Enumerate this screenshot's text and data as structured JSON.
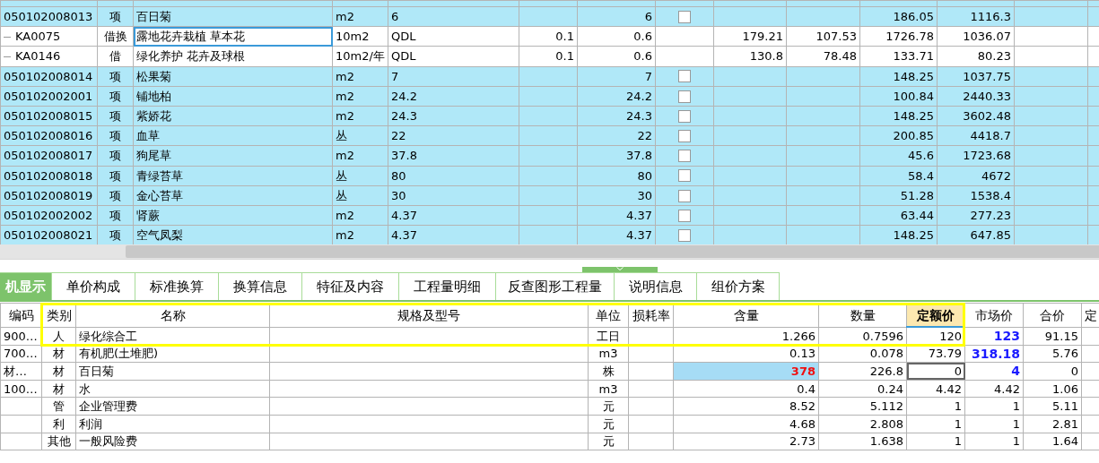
{
  "upper_table": {
    "rows": [
      {
        "kind": "item",
        "code": "050102008013",
        "type": "项",
        "name": "百日菊",
        "unit": "m2",
        "expression": "6",
        "column_6": "",
        "quantity": "6",
        "checkbox": {
          "checked": false
        },
        "column_9": "",
        "column_10": "",
        "column_11": "186.05",
        "column_12": "1116.3",
        "focused": false
      },
      {
        "kind": "sub",
        "code": "KA0075",
        "type": "借换",
        "name": "露地花卉栽植 草本花",
        "unit": "10m2",
        "expression": "QDL",
        "column_6": "0.1",
        "quantity": "0.6",
        "column_9": "179.21",
        "column_10": "107.53",
        "column_11": "1726.78",
        "column_12": "1036.07",
        "focused": true
      },
      {
        "kind": "sub",
        "code": "KA0146",
        "type": "借",
        "name": "绿化养护 花卉及球根",
        "unit": "10m2/年",
        "expression": "QDL",
        "column_6": "0.1",
        "quantity": "0.6",
        "column_9": "130.8",
        "column_10": "78.48",
        "column_11": "133.71",
        "column_12": "80.23",
        "focused": false
      },
      {
        "kind": "item",
        "code": "050102008014",
        "type": "项",
        "name": "松果菊",
        "unit": "m2",
        "expression": "7",
        "column_6": "",
        "quantity": "7",
        "checkbox": {
          "checked": false
        },
        "column_9": "",
        "column_10": "",
        "column_11": "148.25",
        "column_12": "1037.75",
        "focused": false
      },
      {
        "kind": "item",
        "code": "050102002001",
        "type": "项",
        "name": "铺地柏",
        "unit": "m2",
        "expression": "24.2",
        "column_6": "",
        "quantity": "24.2",
        "checkbox": {
          "checked": false
        },
        "column_9": "",
        "column_10": "",
        "column_11": "100.84",
        "column_12": "2440.33",
        "focused": false
      },
      {
        "kind": "item",
        "code": "050102008015",
        "type": "项",
        "name": "紫娇花",
        "unit": "m2",
        "expression": "24.3",
        "column_6": "",
        "quantity": "24.3",
        "checkbox": {
          "checked": false
        },
        "column_9": "",
        "column_10": "",
        "column_11": "148.25",
        "column_12": "3602.48",
        "focused": false
      },
      {
        "kind": "item",
        "code": "050102008016",
        "type": "项",
        "name": "血草",
        "unit": "丛",
        "expression": "22",
        "column_6": "",
        "quantity": "22",
        "checkbox": {
          "checked": false
        },
        "column_9": "",
        "column_10": "",
        "column_11": "200.85",
        "column_12": "4418.7",
        "focused": false
      },
      {
        "kind": "item",
        "code": "050102008017",
        "type": "项",
        "name": "狗尾草",
        "unit": "m2",
        "expression": "37.8",
        "column_6": "",
        "quantity": "37.8",
        "checkbox": {
          "checked": false
        },
        "column_9": "",
        "column_10": "",
        "column_11": "45.6",
        "column_12": "1723.68",
        "focused": false
      },
      {
        "kind": "item",
        "code": "050102008018",
        "type": "项",
        "name": "青绿苔草",
        "unit": "丛",
        "expression": "80",
        "column_6": "",
        "quantity": "80",
        "checkbox": {
          "checked": false
        },
        "column_9": "",
        "column_10": "",
        "column_11": "58.4",
        "column_12": "4672",
        "focused": false
      },
      {
        "kind": "item",
        "code": "050102008019",
        "type": "项",
        "name": "金心苔草",
        "unit": "丛",
        "expression": "30",
        "column_6": "",
        "quantity": "30",
        "checkbox": {
          "checked": false
        },
        "column_9": "",
        "column_10": "",
        "column_11": "51.28",
        "column_12": "1538.4",
        "focused": false
      },
      {
        "kind": "item",
        "code": "050102002002",
        "type": "项",
        "name": "肾蕨",
        "unit": "m2",
        "expression": "4.37",
        "column_6": "",
        "quantity": "4.37",
        "checkbox": {
          "checked": false
        },
        "column_9": "",
        "column_10": "",
        "column_11": "63.44",
        "column_12": "277.23",
        "focused": false
      },
      {
        "kind": "item",
        "code": "050102008021",
        "type": "项",
        "name": "空气凤梨",
        "unit": "m2",
        "expression": "4.37",
        "column_6": "",
        "quantity": "4.37",
        "checkbox": {
          "checked": false
        },
        "column_9": "",
        "column_10": "",
        "column_11": "148.25",
        "column_12": "647.85",
        "focused": false
      }
    ]
  },
  "tabs": [
    {
      "label": "机显示",
      "selected": true
    },
    {
      "label": "单价构成",
      "selected": false
    },
    {
      "label": "标准换算",
      "selected": false
    },
    {
      "label": "换算信息",
      "selected": false
    },
    {
      "label": "特征及内容",
      "selected": false
    },
    {
      "label": "工程量明细",
      "selected": false
    },
    {
      "label": "反查图形工程量",
      "selected": false
    },
    {
      "label": "说明信息",
      "selected": false
    },
    {
      "label": "组价方案",
      "selected": false
    }
  ],
  "detail_table": {
    "columns": [
      {
        "label": "编码",
        "selected": false
      },
      {
        "label": "类别",
        "selected": false
      },
      {
        "label": "名称",
        "selected": false
      },
      {
        "label": "规格及型号",
        "selected": false
      },
      {
        "label": "单位",
        "selected": false
      },
      {
        "label": "损耗率",
        "selected": false
      },
      {
        "label": "含量",
        "selected": false
      },
      {
        "label": "数量",
        "selected": false
      },
      {
        "label": "定额价",
        "selected": true
      },
      {
        "label": "市场价",
        "selected": false
      },
      {
        "label": "合价",
        "selected": false
      },
      {
        "label": "定",
        "selected": false
      }
    ],
    "rows": [
      {
        "code": "900…",
        "type": "人",
        "name": "绿化综合工",
        "spec": "",
        "unit": "工日",
        "loss": "",
        "content": "1.266",
        "quantity": "0.7596",
        "quota_price": "120",
        "market_price": "123",
        "total": "91.15",
        "price_changed": true,
        "content_changed": false,
        "focused": false
      },
      {
        "code": "700…",
        "type": "材",
        "name": "有机肥(土堆肥)",
        "spec": "",
        "unit": "m3",
        "loss": "",
        "content": "0.13",
        "quantity": "0.078",
        "quota_price": "73.79",
        "market_price": "318.18",
        "total": "5.76",
        "price_changed": true,
        "content_changed": false,
        "focused": false
      },
      {
        "code": "材…",
        "type": "材",
        "name": "百日菊",
        "spec": "",
        "unit": "株",
        "loss": "",
        "content": "378",
        "quantity": "226.8",
        "quota_price": "0",
        "market_price": "4",
        "total": "0",
        "price_changed": true,
        "content_changed": true,
        "focused": true
      },
      {
        "code": "100…",
        "type": "材",
        "name": "水",
        "spec": "",
        "unit": "m3",
        "loss": "",
        "content": "0.4",
        "quantity": "0.24",
        "quota_price": "4.42",
        "market_price": "4.42",
        "total": "1.06",
        "price_changed": false,
        "content_changed": false,
        "focused": false
      },
      {
        "code": "",
        "type": "管",
        "name": "企业管理费",
        "spec": "",
        "unit": "元",
        "loss": "",
        "content": "8.52",
        "quantity": "5.112",
        "quota_price": "1",
        "market_price": "1",
        "total": "5.11",
        "price_changed": false,
        "content_changed": false,
        "focused": false
      },
      {
        "code": "",
        "type": "利",
        "name": "利润",
        "spec": "",
        "unit": "元",
        "loss": "",
        "content": "4.68",
        "quantity": "2.808",
        "quota_price": "1",
        "market_price": "1",
        "total": "2.81",
        "price_changed": false,
        "content_changed": false,
        "focused": false
      },
      {
        "code": "",
        "type": "其他",
        "name": "一般风险费",
        "spec": "",
        "unit": "元",
        "loss": "",
        "content": "2.73",
        "quantity": "1.638",
        "quota_price": "1",
        "market_price": "1",
        "total": "1.64",
        "price_changed": false,
        "content_changed": false,
        "focused": false
      }
    ]
  }
}
